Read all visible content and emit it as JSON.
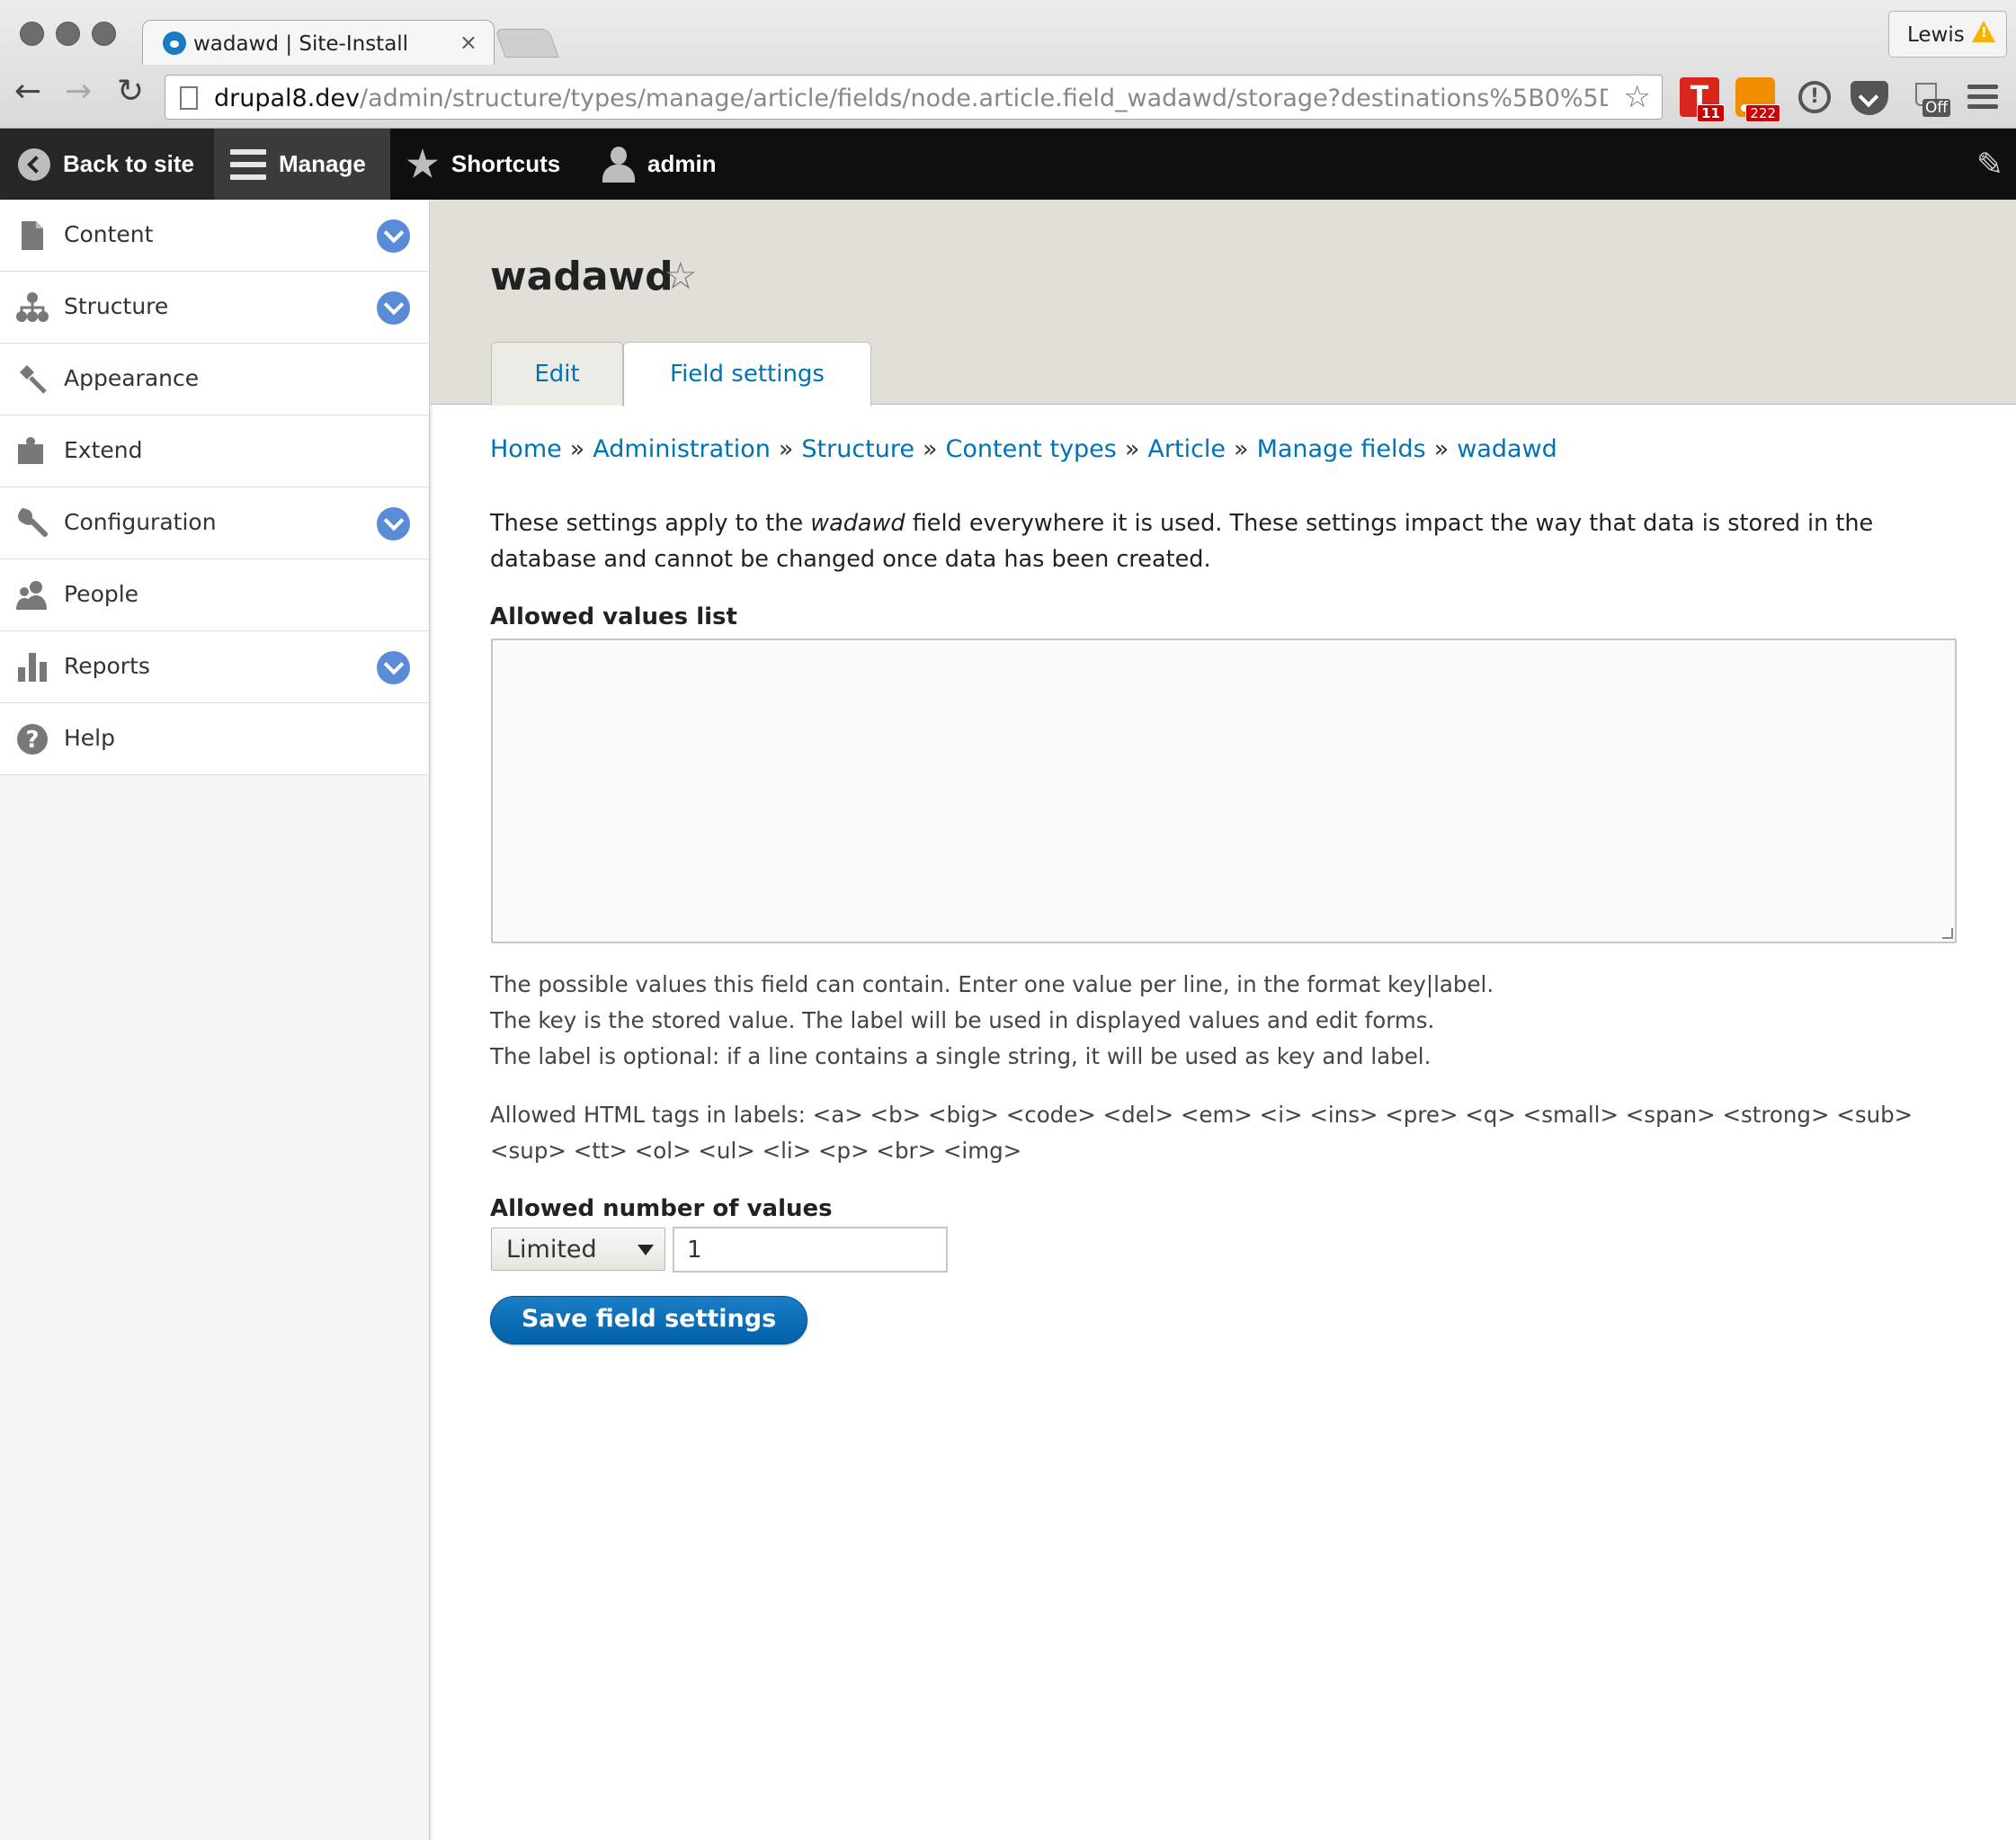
{
  "browser": {
    "tab_title": "wadawd | Site-Install",
    "tab_close": "×",
    "profile_name": "Lewis",
    "url_domain": "drupal8.dev",
    "url_path": "/admin/structure/types/manage/article/fields/node.article.field_wadawd/storage?destinations%5B0%5D%5...",
    "extensions": {
      "t_label": "T",
      "t_badge": "11",
      "rss_badge": "222",
      "off_label": "Off"
    }
  },
  "toolbar": {
    "back_label": "Back to site",
    "manage_label": "Manage",
    "shortcuts_label": "Shortcuts",
    "user_label": "admin"
  },
  "sidebar": {
    "items": [
      {
        "label": "Content",
        "icon": "document-icon",
        "expandable": true
      },
      {
        "label": "Structure",
        "icon": "sitemap-icon",
        "expandable": true
      },
      {
        "label": "Appearance",
        "icon": "paintbrush-icon",
        "expandable": false
      },
      {
        "label": "Extend",
        "icon": "puzzle-icon",
        "expandable": false
      },
      {
        "label": "Configuration",
        "icon": "wrench-icon",
        "expandable": true
      },
      {
        "label": "People",
        "icon": "people-icon",
        "expandable": false
      },
      {
        "label": "Reports",
        "icon": "bar-chart-icon",
        "expandable": true
      },
      {
        "label": "Help",
        "icon": "question-icon",
        "expandable": false
      }
    ]
  },
  "page": {
    "title": "wadawd",
    "tabs": [
      {
        "label": "Edit",
        "active": false
      },
      {
        "label": "Field settings",
        "active": true
      }
    ],
    "breadcrumb": [
      "Home",
      "Administration",
      "Structure",
      "Content types",
      "Article",
      "Manage fields",
      "wadawd"
    ],
    "breadcrumb_separator": "»",
    "intro_before": "These settings apply to the ",
    "intro_field": "wadawd",
    "intro_after": " field everywhere it is used. These settings impact the way that data is stored in the database and cannot be changed once data has been created.",
    "allowed_values_label": "Allowed values list",
    "allowed_values_value": "",
    "description_lines": [
      "The possible values this field can contain. Enter one value per line, in the format key|label.",
      "The key is the stored value. The label will be used in displayed values and edit forms.",
      "The label is optional: if a line contains a single string, it will be used as key and label."
    ],
    "allowed_tags": "Allowed HTML tags in labels: <a> <b> <big> <code> <del> <em> <i> <ins> <pre> <q> <small> <span> <strong> <sub> <sup> <tt> <ol> <ul> <li> <p> <br> <img>",
    "allowed_number_label": "Allowed number of values",
    "cardinality_selected": "Limited",
    "cardinality_number": "1",
    "save_button": "Save field settings"
  },
  "colors": {
    "link": "#0073b5",
    "toolbar_bg": "#0f0f0f",
    "primary_button": "#0071b8",
    "toggle": "#5a8bd6"
  }
}
